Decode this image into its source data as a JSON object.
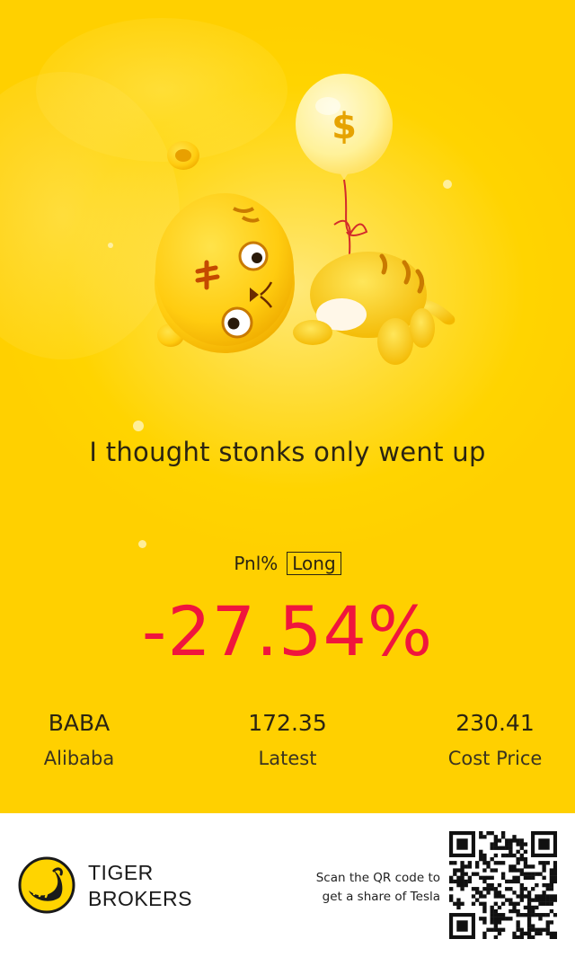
{
  "card": {
    "tagline": "I thought stonks only went up",
    "pnl_label": "Pnl%",
    "position_badge": "Long",
    "pnl_value": "-27.54%",
    "balloon_symbol": "$",
    "stats": [
      {
        "value": "BABA",
        "label": "Alibaba"
      },
      {
        "value": "172.35",
        "label": "Latest"
      },
      {
        "value": "230.41",
        "label": "Cost Price"
      }
    ],
    "colors": {
      "background": "#ffd400",
      "loss": "#f0153d",
      "text": "#2b2412"
    }
  },
  "footer": {
    "brand_line1": "TIGER",
    "brand_line2": "BROKERS",
    "scan_line1": "Scan the QR code to",
    "scan_line2": "get a share of Tesla",
    "icons": [
      "tiger-brokers-logo-icon",
      "qr-code-icon"
    ]
  }
}
